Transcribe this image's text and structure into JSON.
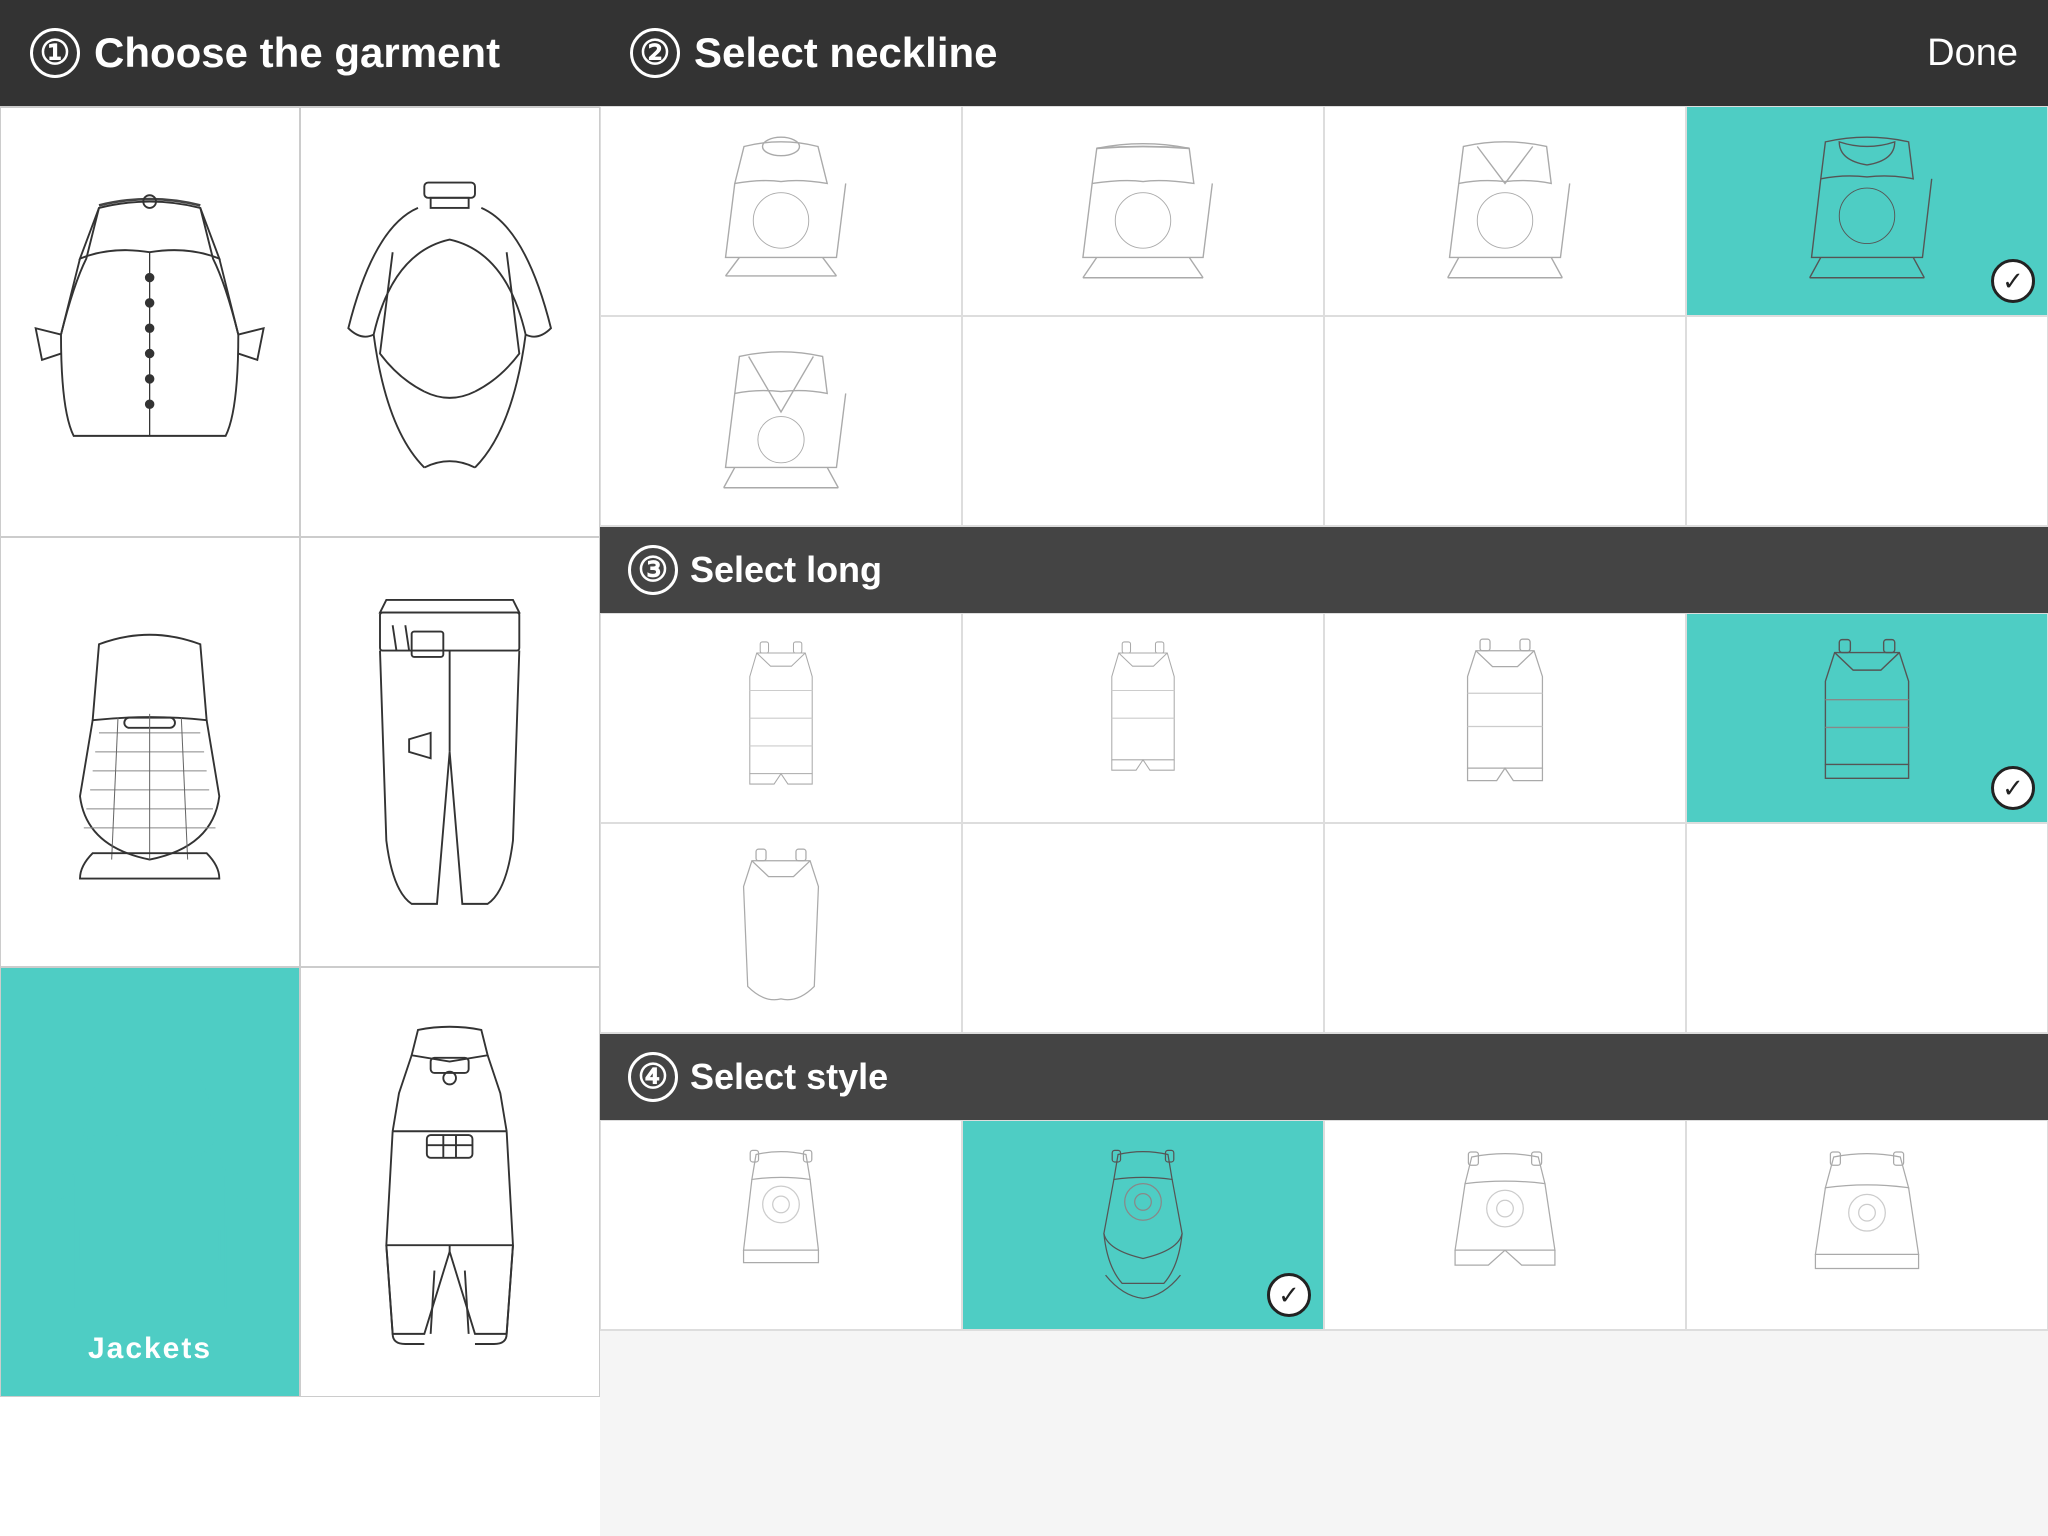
{
  "left": {
    "step_num": "①",
    "title": "Choose the garment",
    "garments": [
      {
        "id": "blouse",
        "label": "Blouse",
        "selected": false
      },
      {
        "id": "cape",
        "label": "Cape",
        "selected": false
      },
      {
        "id": "corset",
        "label": "Corset",
        "selected": false
      },
      {
        "id": "trousers",
        "label": "Trousers",
        "selected": false
      },
      {
        "id": "jacket",
        "label": "Jackets",
        "selected": true
      },
      {
        "id": "jumpsuit",
        "label": "Jumpsuit",
        "selected": false
      }
    ]
  },
  "right": {
    "done_label": "Done",
    "neckline": {
      "step_num": "②",
      "title": "Select neckline",
      "options": [
        {
          "id": "crew",
          "selected": false
        },
        {
          "id": "boat",
          "selected": false
        },
        {
          "id": "vneck",
          "selected": false
        },
        {
          "id": "collar",
          "selected": true
        },
        {
          "id": "deep-v",
          "selected": false
        }
      ]
    },
    "long": {
      "step_num": "③",
      "title": "Select long",
      "options": [
        {
          "id": "long1",
          "selected": false
        },
        {
          "id": "long2",
          "selected": false
        },
        {
          "id": "long3",
          "selected": false
        },
        {
          "id": "long4",
          "selected": true
        },
        {
          "id": "long5",
          "selected": false
        }
      ]
    },
    "style": {
      "step_num": "④",
      "title": "Select style",
      "options": [
        {
          "id": "style1",
          "selected": false
        },
        {
          "id": "style2",
          "selected": true
        },
        {
          "id": "style3",
          "selected": false
        },
        {
          "id": "style4",
          "selected": false
        }
      ]
    }
  }
}
